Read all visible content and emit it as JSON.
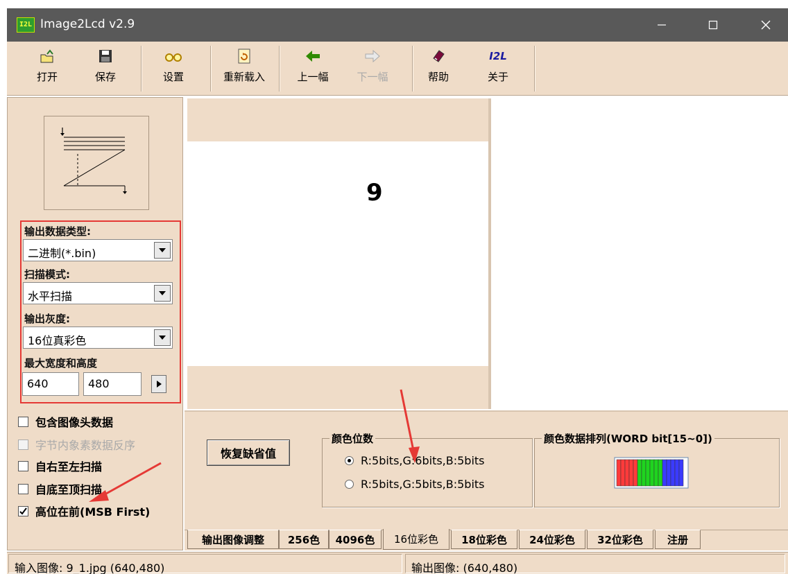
{
  "window": {
    "title": "Image2Lcd v2.9",
    "icon_text": "I2L"
  },
  "toolbar": {
    "open": "打开",
    "save": "保存",
    "settings": "设置",
    "reload": "重新载入",
    "prev": "上一幅",
    "next": "下一幅",
    "help": "帮助",
    "about_icon_text": "I2L",
    "about": "关于"
  },
  "left": {
    "output_type_label": "输出数据类型:",
    "output_type_value": "二进制(*.bin)",
    "scan_mode_label": "扫描模式:",
    "scan_mode_value": "水平扫描",
    "gray_label": "输出灰度:",
    "gray_value": "16位真彩色",
    "max_size_label": "最大宽度和高度",
    "max_width": "640",
    "max_height": "480",
    "checkboxes": [
      {
        "label": "包含图像头数据",
        "checked": false,
        "enabled": true
      },
      {
        "label": "字节内象素数据反序",
        "checked": false,
        "enabled": false
      },
      {
        "label": "自右至左扫描",
        "checked": false,
        "enabled": true
      },
      {
        "label": "自底至顶扫描",
        "checked": false,
        "enabled": true
      },
      {
        "label": "高位在前(MSB First)",
        "checked": true,
        "enabled": true
      }
    ]
  },
  "preview": {
    "input_digit": "9"
  },
  "settings": {
    "restore_default": "恢复缺省值",
    "color_bits_title": "颜色位数",
    "color_bits_option1": "R:5bits,G:6bits,B:5bits",
    "color_bits_option2": "R:5bits,G:5bits,B:5bits",
    "color_bits_selected": 0,
    "color_order_title": "颜色数据排列(WORD bit[15~0])",
    "bit_colors": [
      "#ff3b3b",
      "#1fd41f",
      "#3b3bff"
    ]
  },
  "tabs": [
    "输出图像调整",
    "256色",
    "4096色",
    "16位彩色",
    "18位彩色",
    "24位彩色",
    "32位彩色",
    "注册"
  ],
  "active_tab": "16位彩色",
  "status": {
    "input": "输入图像: 9_1.jpg (640,480)",
    "output": "输出图像: (640,480)"
  },
  "annotation_colors": {
    "highlight_box": "#e53935",
    "arrow": "#e53935"
  }
}
